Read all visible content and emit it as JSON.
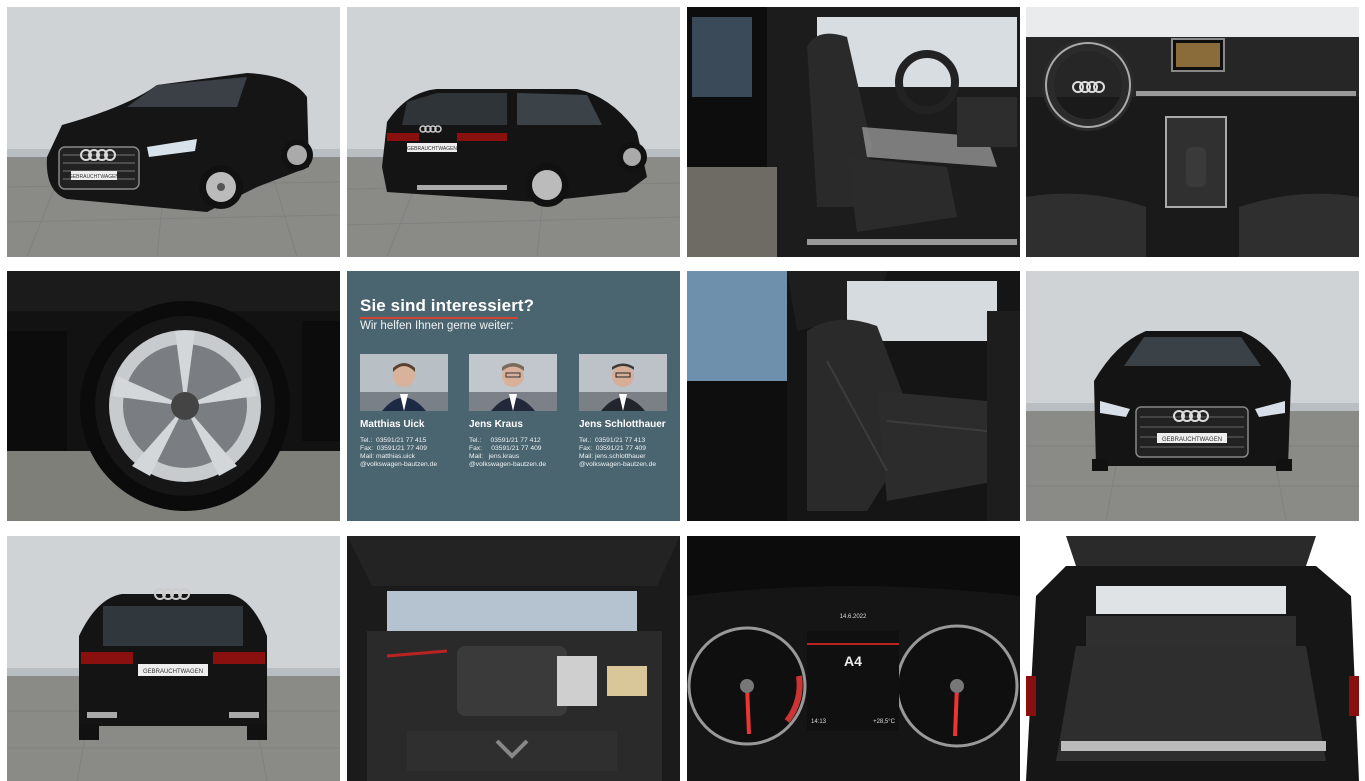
{
  "gallery": {
    "photos": [
      {
        "name": "photo-front-three-quarter",
        "plate": "GEBRAUCHTWAGEN"
      },
      {
        "name": "photo-rear-three-quarter",
        "plate": "GEBRAUCHTWAGEN"
      },
      {
        "name": "photo-front-seats"
      },
      {
        "name": "photo-dashboard"
      },
      {
        "name": "photo-wheel"
      },
      {
        "name": "photo-rear-seats"
      },
      {
        "name": "photo-front",
        "plate": "GEBRAUCHTWAGEN"
      },
      {
        "name": "photo-rear",
        "plate": "GEBRAUCHTWAGEN"
      },
      {
        "name": "photo-engine-bay"
      },
      {
        "name": "photo-instrument-cluster",
        "cluster_model": "A4",
        "cluster_date": "14.6.2022",
        "cluster_time": "14:13",
        "cluster_temp": "+28,5°C"
      },
      {
        "name": "photo-trunk"
      }
    ]
  },
  "contact": {
    "title": "Sie sind interessiert?",
    "subtitle": "Wir helfen Ihnen gerne weiter:",
    "people": [
      {
        "name": "Matthias Uick",
        "info": "Tel.:  03591/21 77 415\nFax:  03591/21 77 409\nMail: matthias.uick\n@volkswagen-bautzen.de"
      },
      {
        "name": "Jens Kraus",
        "info": "Tel.:     03591/21 77 412\nFax:     03591/21 77 409\nMail:   jens.kraus\n@volkswagen-bautzen.de"
      },
      {
        "name": "Jens Schlotthauer",
        "info": "Tel.:  03591/21 77 413\nFax:  03591/21 77 409\nMail: jens.schlotthauer\n@volkswagen-bautzen.de"
      }
    ]
  },
  "colors": {
    "card_bg": "#4a6470",
    "accent": "#d0452f",
    "car_paint": "#151515"
  }
}
